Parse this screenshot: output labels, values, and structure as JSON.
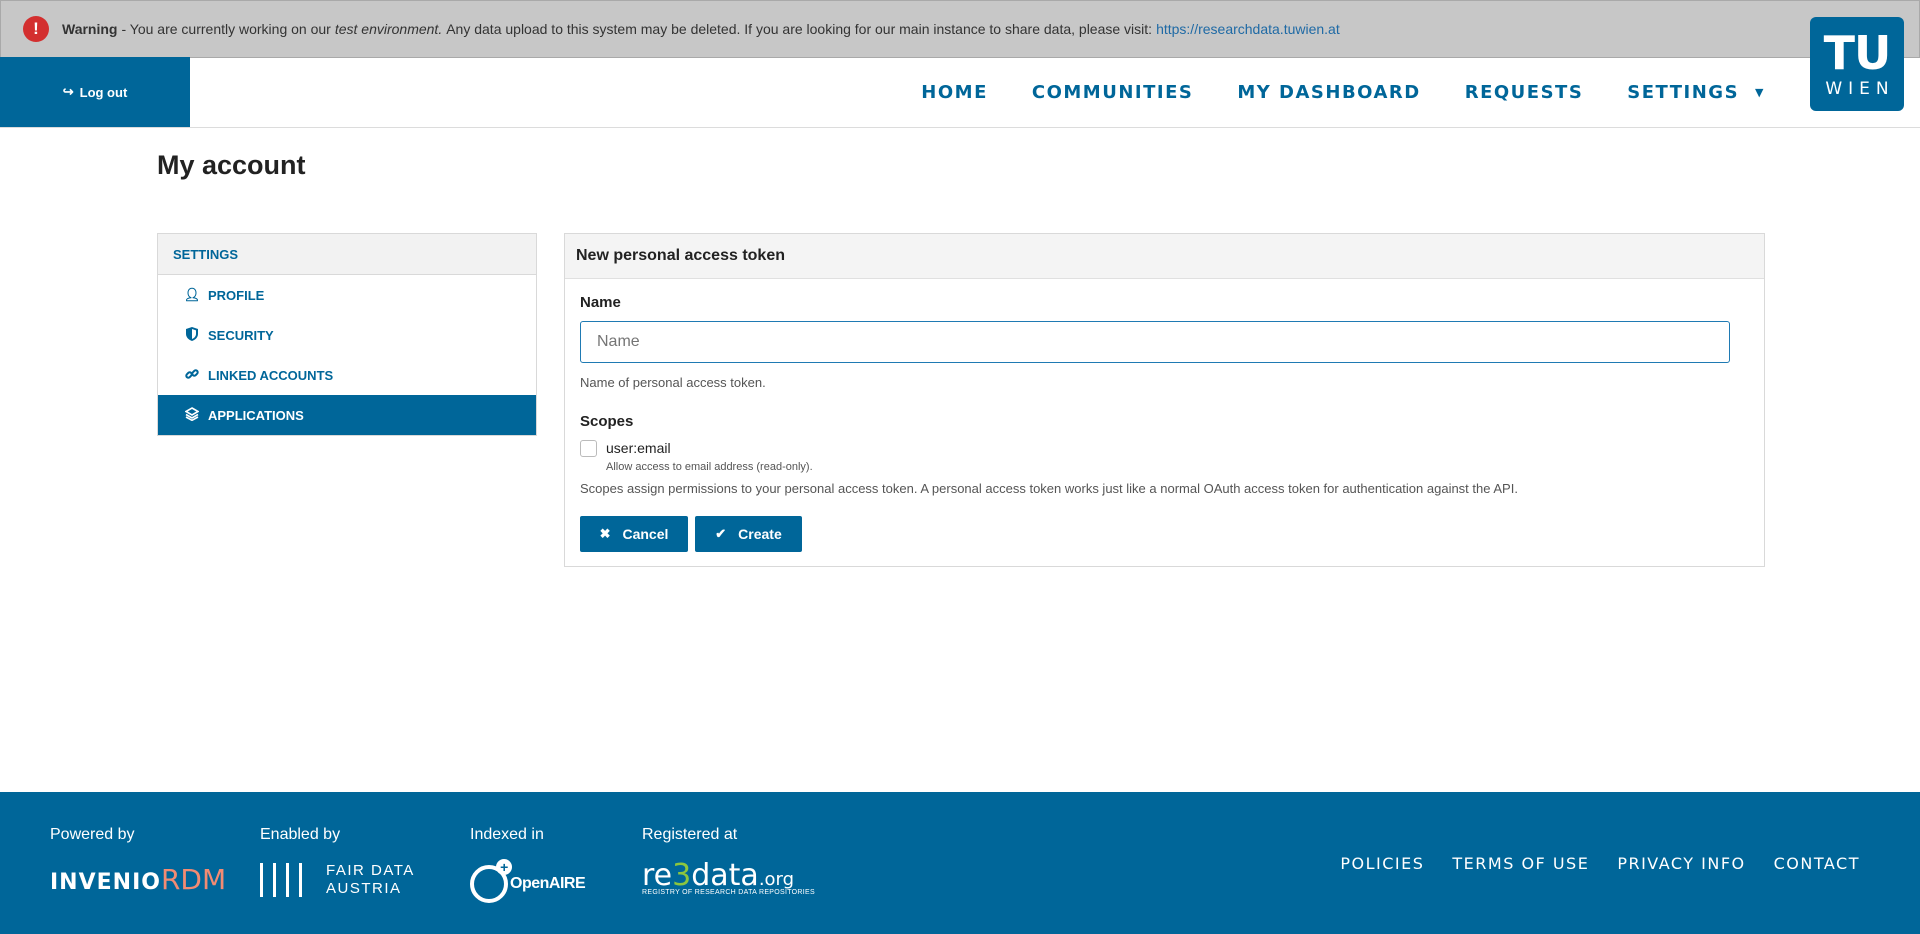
{
  "warning": {
    "icon": "exclamation-icon",
    "title": "Warning",
    "text_before": "- You are currently working on our",
    "emphasis": "test environment.",
    "text_after": "Any data upload to this system may be deleted. If you are looking for our main instance to share data, please visit:",
    "link": "https://researchdata.tuwien.at"
  },
  "header": {
    "logout_label": "Log out",
    "nav": [
      "HOME",
      "COMMUNITIES",
      "MY DASHBOARD",
      "REQUESTS",
      "SETTINGS"
    ],
    "logo_top": "TU",
    "logo_bottom": "WIEN"
  },
  "page": {
    "title": "My account"
  },
  "sidebar": {
    "heading": "SETTINGS",
    "items": [
      {
        "label": "PROFILE",
        "icon": "user-icon"
      },
      {
        "label": "SECURITY",
        "icon": "shield-icon"
      },
      {
        "label": "LINKED ACCOUNTS",
        "icon": "link-icon"
      },
      {
        "label": "APPLICATIONS",
        "icon": "cube-icon",
        "active": true
      }
    ]
  },
  "form": {
    "title": "New personal access token",
    "name_label": "Name",
    "name_placeholder": "Name",
    "name_value": "",
    "name_help": "Name of personal access token.",
    "scopes_label": "Scopes",
    "scope_name": "user:email",
    "scope_checked": false,
    "scope_desc": "Allow access to email address (read-only).",
    "scopes_help": "Scopes assign permissions to your personal access token. A personal access token works just like a normal OAuth access token for authentication against the API.",
    "cancel_label": "Cancel",
    "create_label": "Create"
  },
  "footer": {
    "powered_by": "Powered by",
    "enabled_by": "Enabled by",
    "indexed_in": "Indexed in",
    "registered_at": "Registered at",
    "invenio_a": "INVENIO",
    "invenio_b": "RDM",
    "fda_line1": "FAIR DATA",
    "fda_line2": "AUSTRIA",
    "openaire": "OpenAIRE",
    "re3_a": "re",
    "re3_b": "3",
    "re3_c": "data",
    "re3_d": ".org",
    "re3_small": "REGISTRY OF RESEARCH DATA REPOSITORIES",
    "links": [
      "POLICIES",
      "TERMS OF USE",
      "PRIVACY INFO",
      "CONTACT"
    ]
  },
  "colors": {
    "primary": "#006699",
    "warning_bg": "#c7c7c7",
    "alert_red": "#d32f2f",
    "accent_green": "#8cc63f",
    "accent_salmon": "#f28b73"
  }
}
